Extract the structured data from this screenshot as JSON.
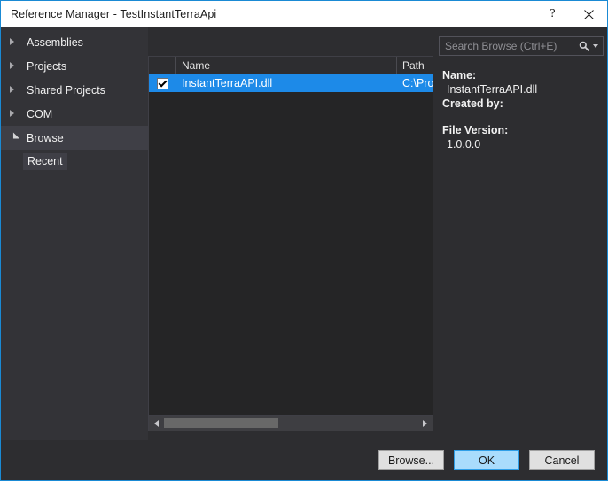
{
  "window": {
    "title": "Reference Manager - TestInstantTerraApi",
    "help_button": "?",
    "close_button": "✕",
    "accent_color": "#1a8ad4",
    "background_color": "#2d2d30"
  },
  "sidebar": {
    "items": [
      {
        "label": "Assemblies",
        "state": "collapsed",
        "selected": false
      },
      {
        "label": "Projects",
        "state": "collapsed",
        "selected": false
      },
      {
        "label": "Shared Projects",
        "state": "collapsed",
        "selected": false
      },
      {
        "label": "COM",
        "state": "collapsed",
        "selected": false
      },
      {
        "label": "Browse",
        "state": "expanded",
        "selected": true
      }
    ],
    "child": {
      "label": "Recent",
      "selected": true
    }
  },
  "list": {
    "columns": {
      "check": "",
      "name": "Name",
      "path": "Path"
    },
    "rows": [
      {
        "checked": true,
        "name": "InstantTerraAPI.dll",
        "path": "C:\\Pro",
        "selected": true
      }
    ],
    "scrollbar": {
      "left_arrow": "◀",
      "right_arrow": "▶",
      "thumb_percent": "45"
    }
  },
  "search": {
    "placeholder": "Search Browse (Ctrl+E)",
    "value": ""
  },
  "details": {
    "name_label": "Name:",
    "name_value": "InstantTerraAPI.dll",
    "created_by_label": "Created by:",
    "created_by_value": "",
    "file_version_label": "File Version:",
    "file_version_value": "1.0.0.0"
  },
  "footer": {
    "browse_label": "Browse...",
    "ok_label": "OK",
    "cancel_label": "Cancel"
  }
}
